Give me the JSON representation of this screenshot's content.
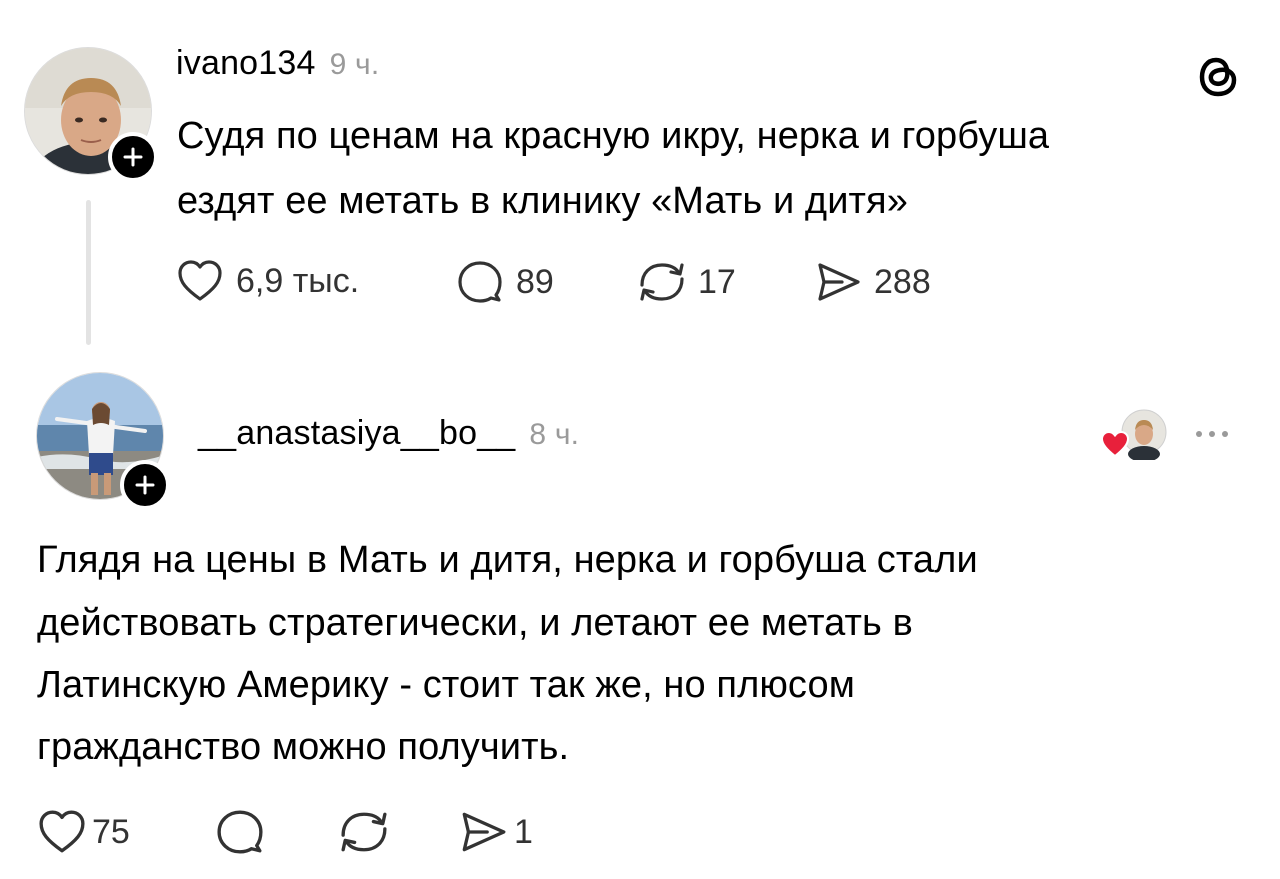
{
  "post": {
    "username": "ivano134",
    "time": "9 ч.",
    "text_line1": "Судя по ценам на красную икру, нерка и горбуша",
    "text_line2": "ездят ее метать в клинику «Мать и дитя»",
    "likes": "6,9 тыс.",
    "replies": "89",
    "reposts": "17",
    "shares": "288",
    "icons": {
      "app": "threads-logo-icon",
      "like": "heart-icon",
      "reply": "comment-icon",
      "repost": "repost-icon",
      "share": "share-icon"
    }
  },
  "reply": {
    "username": "__anastasiya__bo__",
    "time": "8 ч.",
    "text_lines": [
      "Глядя на цены в Мать и дитя, нерка и горбуша стали",
      "действовать стратегически, и летают ее метать в",
      "Латинскую Америку - стоит так же, но плюсом",
      "гражданство можно получить."
    ],
    "likes": "75",
    "shares": "1",
    "icons": {
      "liked_by_author": "liked-by-author-heart-icon",
      "more": "more-options-icon"
    },
    "colors": {
      "heart": "#e8203b"
    }
  }
}
